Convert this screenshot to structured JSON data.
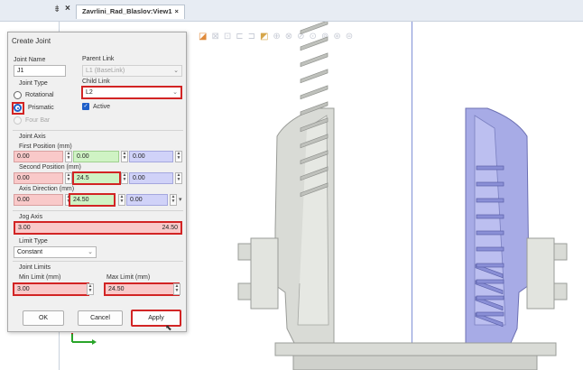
{
  "topbar": {
    "pin_icon": "pin-icon",
    "close_label": "×",
    "tab_title": "Zavrlini_Rad_Blaslov:View1",
    "tab_close": "×"
  },
  "dialog": {
    "title": "Create Joint",
    "joint_name": {
      "label": "Joint Name",
      "value": "J1"
    },
    "parent_link": {
      "label": "Parent Link",
      "value": "L1 (BaseLink)"
    },
    "child_link": {
      "label": "Child Link",
      "value": "L2"
    },
    "joint_type": {
      "label": "Joint Type",
      "options": [
        "Rotational",
        "Prismatic",
        "Four Bar"
      ],
      "selected": "Prismatic"
    },
    "active": {
      "label": "Active",
      "checked": true
    },
    "joint_axis": {
      "label": "Joint Axis",
      "first_position": {
        "label": "First Position (mm)",
        "x": "0.00",
        "y": "0.00",
        "z": "0.00"
      },
      "second_position": {
        "label": "Second Position (mm)",
        "x": "0.00",
        "y": "24.5",
        "z": "0.00"
      },
      "axis_direction": {
        "label": "Axis Direction (mm)",
        "x": "0.00",
        "y": "24.50",
        "z": "0.00"
      }
    },
    "jog_axis": {
      "label": "Jog Axis",
      "value": "3.00",
      "max": "24.50"
    },
    "limit_type": {
      "label": "Limit Type",
      "value": "Constant"
    },
    "joint_limits": {
      "label": "Joint Limits",
      "min": {
        "label": "Min Limit (mm)",
        "value": "3.00"
      },
      "max": {
        "label": "Max Limit (mm)",
        "value": "24.50"
      }
    },
    "buttons": {
      "ok": "OK",
      "cancel": "Cancel",
      "apply": "Apply"
    }
  },
  "colors": {
    "highlight": "#d22424",
    "x_field": "#f9c9c9",
    "y_field": "#cff3c4",
    "z_field": "#d0d2f8",
    "model_left": "#d9dbd6",
    "model_right": "#a7abe6",
    "accent": "#1d5fc9"
  }
}
